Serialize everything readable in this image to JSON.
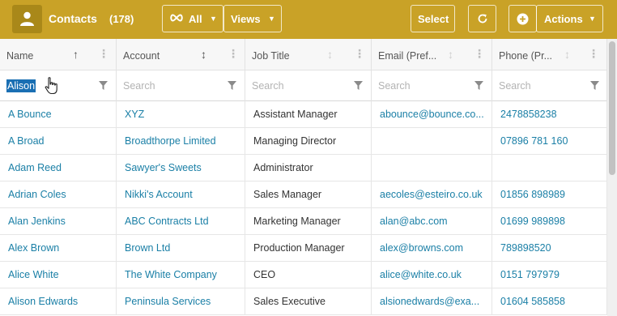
{
  "toolbar": {
    "title": "Contacts",
    "count": "(178)",
    "all_label": "All",
    "views_label": "Views",
    "select_label": "Select",
    "actions_label": "Actions",
    "background": "#c9a227"
  },
  "columns": [
    {
      "label": "Name",
      "sort_icon": "sort-ascending-icon"
    },
    {
      "label": "Account",
      "sort_icon": "sort-both-icon"
    },
    {
      "label": "Job Title",
      "sort_icon": "sort-both-icon"
    },
    {
      "label": "Email (Pref...",
      "sort_icon": "sort-both-icon"
    },
    {
      "label": "Phone (Pr...",
      "sort_icon": "sort-both-icon"
    }
  ],
  "filters": {
    "name_value": "Alison",
    "placeholder": "Search"
  },
  "rows": [
    {
      "name": "A Bounce",
      "account": "XYZ",
      "job": "Assistant Manager",
      "email": "abounce@bounce.co...",
      "phone": "2478858238"
    },
    {
      "name": "A Broad",
      "account": "Broadthorpe Limited",
      "job": "Managing Director",
      "email": "",
      "phone": "07896 781 160"
    },
    {
      "name": "Adam Reed",
      "account": "Sawyer's Sweets",
      "job": "Administrator",
      "email": "",
      "phone": ""
    },
    {
      "name": "Adrian Coles",
      "account": "Nikki's Account",
      "job": "Sales Manager",
      "email": "aecoles@esteiro.co.uk",
      "phone": "01856 898989"
    },
    {
      "name": "Alan Jenkins",
      "account": "ABC Contracts Ltd",
      "job": "Marketing Manager",
      "email": "alan@abc.com",
      "phone": "01699 989898"
    },
    {
      "name": "Alex Brown",
      "account": "Brown Ltd",
      "job": "Production Manager",
      "email": "alex@browns.com",
      "phone": "789898520"
    },
    {
      "name": "Alice White",
      "account": "The White Company",
      "job": "CEO",
      "email": "alice@white.co.uk",
      "phone": "0151 797979"
    },
    {
      "name": "Alison Edwards",
      "account": "Peninsula Services",
      "job": "Sales Executive",
      "email": "alsionedwards@exa...",
      "phone": "01604 585858"
    }
  ]
}
